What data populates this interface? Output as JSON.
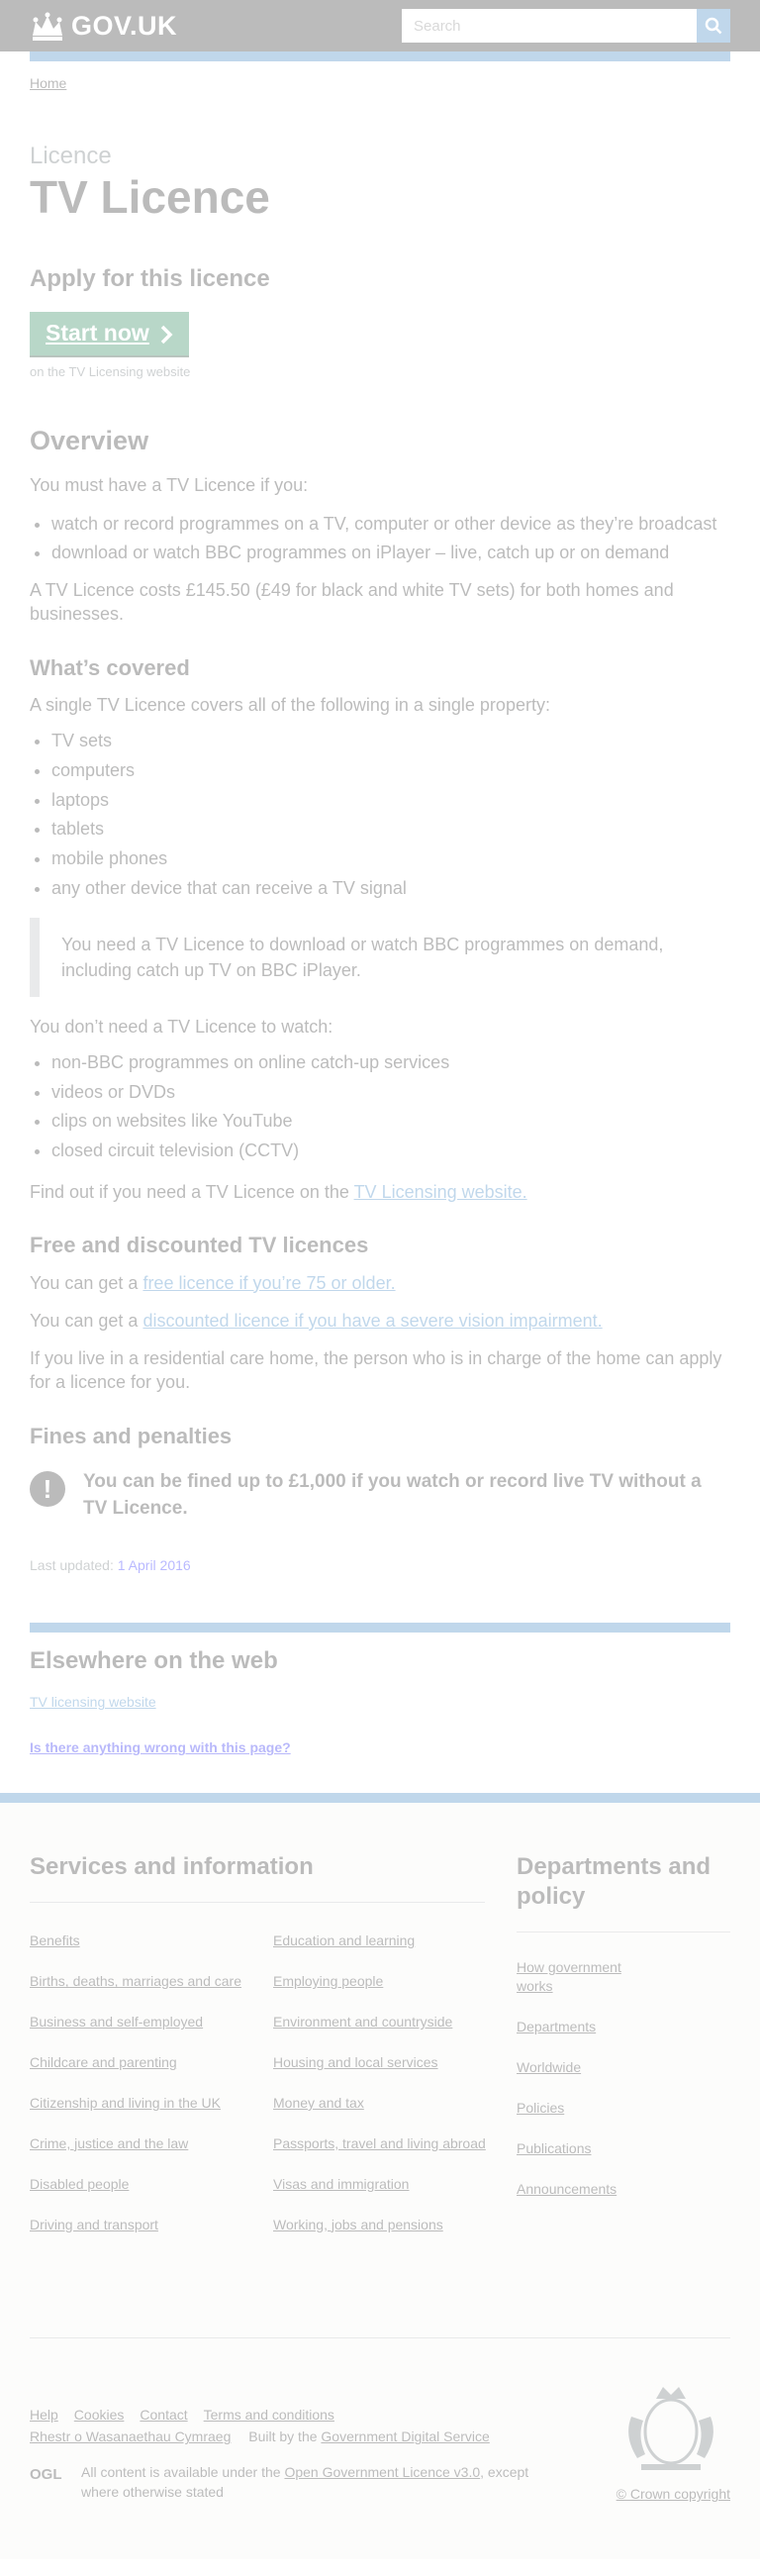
{
  "header": {
    "logo_text": "GOV.UK",
    "search_placeholder": "Search"
  },
  "breadcrumb": {
    "home": "Home"
  },
  "page": {
    "caption": "Licence",
    "title": "TV Licence"
  },
  "apply": {
    "heading": "Apply for this licence",
    "button_label": "Start now",
    "button_note": "on the TV Licensing website"
  },
  "overview": {
    "heading": "Overview",
    "intro": "You must have a TV Licence if you:",
    "items": [
      "watch or record programmes on a TV, computer or other device as they’re broadcast",
      "download or watch BBC programmes on iPlayer – live, catch up or on demand"
    ],
    "cost": "A TV Licence costs £145.50 (£49 for black and white TV sets) for both homes and businesses."
  },
  "covered": {
    "heading": "What’s covered",
    "intro": "A single TV Licence covers all of the following in a single property:",
    "items": [
      "TV sets",
      "computers",
      "laptops",
      "tablets",
      "mobile phones",
      "any other device that can receive a TV signal"
    ],
    "inset": "You need a TV Licence to download or watch BBC programmes on demand, including catch up TV on BBC iPlayer.",
    "not_needed_intro": "You don’t need a TV Licence to watch:",
    "not_needed_items": [
      "non-BBC programmes on online catch-up services",
      "videos or DVDs",
      "clips on websites like YouTube",
      "closed circuit television (CCTV)"
    ],
    "find_out_prefix": "Find out if you need a TV Licence on the ",
    "find_out_link": "TV Licensing website."
  },
  "discounts": {
    "heading": "Free and discounted TV licences",
    "free_prefix": "You can get a ",
    "free_link": "free licence if you’re 75 or older.",
    "discount_prefix": "You can get a ",
    "discount_link": "discounted licence if you have a severe vision impairment.",
    "care_home": "If you live in a residential care home, the person who is in charge of the home can apply for a licence for you."
  },
  "fines": {
    "heading": "Fines and penalties",
    "warning_icon": "!",
    "warning": "You can be fined up to £1,000 if you watch or record live TV without a TV Licence."
  },
  "meta": {
    "last_updated_label": "Last updated:",
    "last_updated_value": "1 April 2016"
  },
  "related": {
    "heading": "Elsewhere on the web",
    "link": "TV licensing website"
  },
  "feedback": {
    "link": "Is there anything wrong with this page?"
  },
  "footer": {
    "services_heading": "Services and information",
    "services_col1": [
      "Benefits",
      "Births, deaths, marriages and care",
      "Business and self-employed",
      "Childcare and parenting",
      "Citizenship and living in the UK",
      "Crime, justice and the law",
      "Disabled people",
      "Driving and transport"
    ],
    "services_col2": [
      "Education and learning",
      "Employing people",
      "Environment and countryside",
      "Housing and local services",
      "Money and tax",
      "Passports, travel and living abroad",
      "Visas and immigration",
      "Working, jobs and pensions"
    ],
    "departments_heading": "Departments and policy",
    "departments": [
      "How government works",
      "Departments",
      "Worldwide",
      "Policies",
      "Publications",
      "Announcements"
    ],
    "meta_links": [
      "Help",
      "Cookies",
      "Contact",
      "Terms and conditions"
    ],
    "welsh": "Rhestr o Wasanaethau Cymraeg",
    "built_by_prefix": "Built by the ",
    "built_by_link": "Government Digital Service",
    "ogl_logo_text": "OGL",
    "licence_prefix": "All content is available under the ",
    "licence_link": "Open Government Licence v3.0",
    "licence_suffix": ", except where otherwise stated",
    "copyright": "© Crown copyright"
  }
}
